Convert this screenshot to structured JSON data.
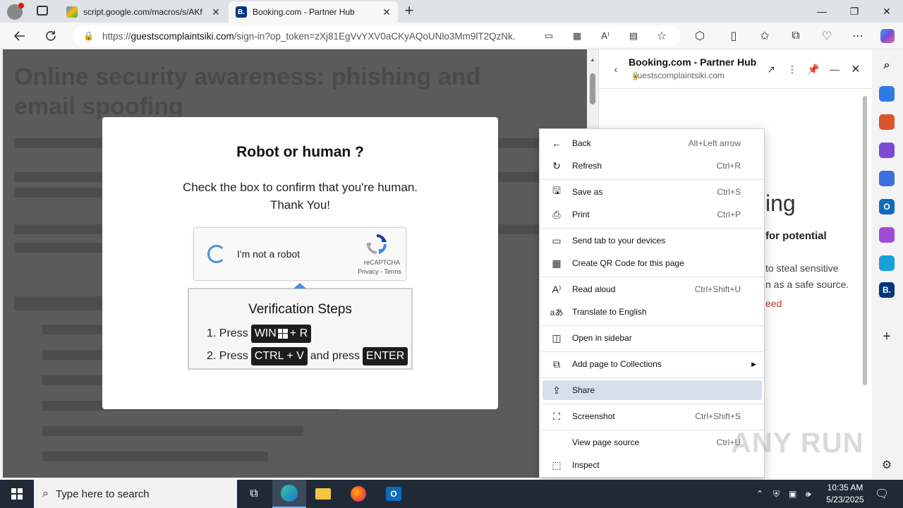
{
  "browser": {
    "tabs": [
      {
        "label": "script.google.com/macros/s/AKf",
        "active": false
      },
      {
        "label": "Booking.com - Partner Hub",
        "active": true,
        "favicon_text": "B."
      }
    ],
    "new_tab_label": "+",
    "url_prefix": "https://",
    "url_host": "guestscomplaintsiki.com",
    "url_path": "/sign-in?op_token=zXj81EgVvYXV0aCKyAQoUNlo3Mm9lT2QzNk..."
  },
  "page": {
    "heading": "Online security awareness: phishing and email spoofing"
  },
  "modal": {
    "title": "Robot or human ?",
    "line1": "Check the box to confirm that you're human.",
    "line2": "Thank You!",
    "captcha_label": "I'm not a robot",
    "captcha_brand": "reCAPTCHA",
    "captcha_terms": "Privacy - Terms",
    "verify_title": "Verification Steps",
    "step1_prefix": "1. Press",
    "step1_key_a": "WIN",
    "step1_key_b": "+ R",
    "step2_prefix": "2. Press",
    "step2_key": "CTRL + V",
    "step2_mid": "and press",
    "step2_key2": "ENTER"
  },
  "sidepanel": {
    "title": "Booking.com - Partner Hub",
    "url": "guestscomplaintsiki.com",
    "frag_heading": "ing",
    "frag_sub": "for potential",
    "frag_line1": "to steal sensitive",
    "frag_line2": "n as a safe source.",
    "frag_link": "eed"
  },
  "context_menu": {
    "items": [
      {
        "label": "Back",
        "shortcut": "Alt+Left arrow",
        "icon": "back-arrow-icon"
      },
      {
        "label": "Refresh",
        "shortcut": "Ctrl+R",
        "icon": "refresh-icon"
      },
      {
        "label": "Save as",
        "shortcut": "Ctrl+S",
        "icon": "save-icon"
      },
      {
        "label": "Print",
        "shortcut": "Ctrl+P",
        "icon": "print-icon"
      },
      {
        "label": "Send tab to your devices",
        "shortcut": "",
        "icon": "devices-icon"
      },
      {
        "label": "Create QR Code for this page",
        "shortcut": "",
        "icon": "qr-code-icon"
      },
      {
        "label": "Read aloud",
        "shortcut": "Ctrl+Shift+U",
        "icon": "read-aloud-icon"
      },
      {
        "label": "Translate to English",
        "shortcut": "",
        "icon": "translate-icon"
      },
      {
        "label": "Open in sidebar",
        "shortcut": "",
        "icon": "sidebar-icon"
      },
      {
        "label": "Add page to Collections",
        "shortcut": "",
        "icon": "collections-icon"
      },
      {
        "label": "Share",
        "shortcut": "",
        "icon": "share-icon"
      },
      {
        "label": "Screenshot",
        "shortcut": "Ctrl+Shift+S",
        "icon": "screenshot-icon"
      },
      {
        "label": "View page source",
        "shortcut": "Ctrl+U",
        "icon": ""
      },
      {
        "label": "Inspect",
        "shortcut": "",
        "icon": "inspect-icon"
      }
    ]
  },
  "taskbar": {
    "search_placeholder": "Type here to search",
    "time": "10:35 AM",
    "date": "5/23/2025"
  },
  "watermark": "ANY RUN",
  "colors": {
    "highlight": "#d6e0ea",
    "taskbar": "#1f2a36",
    "overlay": "#5b5b5b"
  }
}
